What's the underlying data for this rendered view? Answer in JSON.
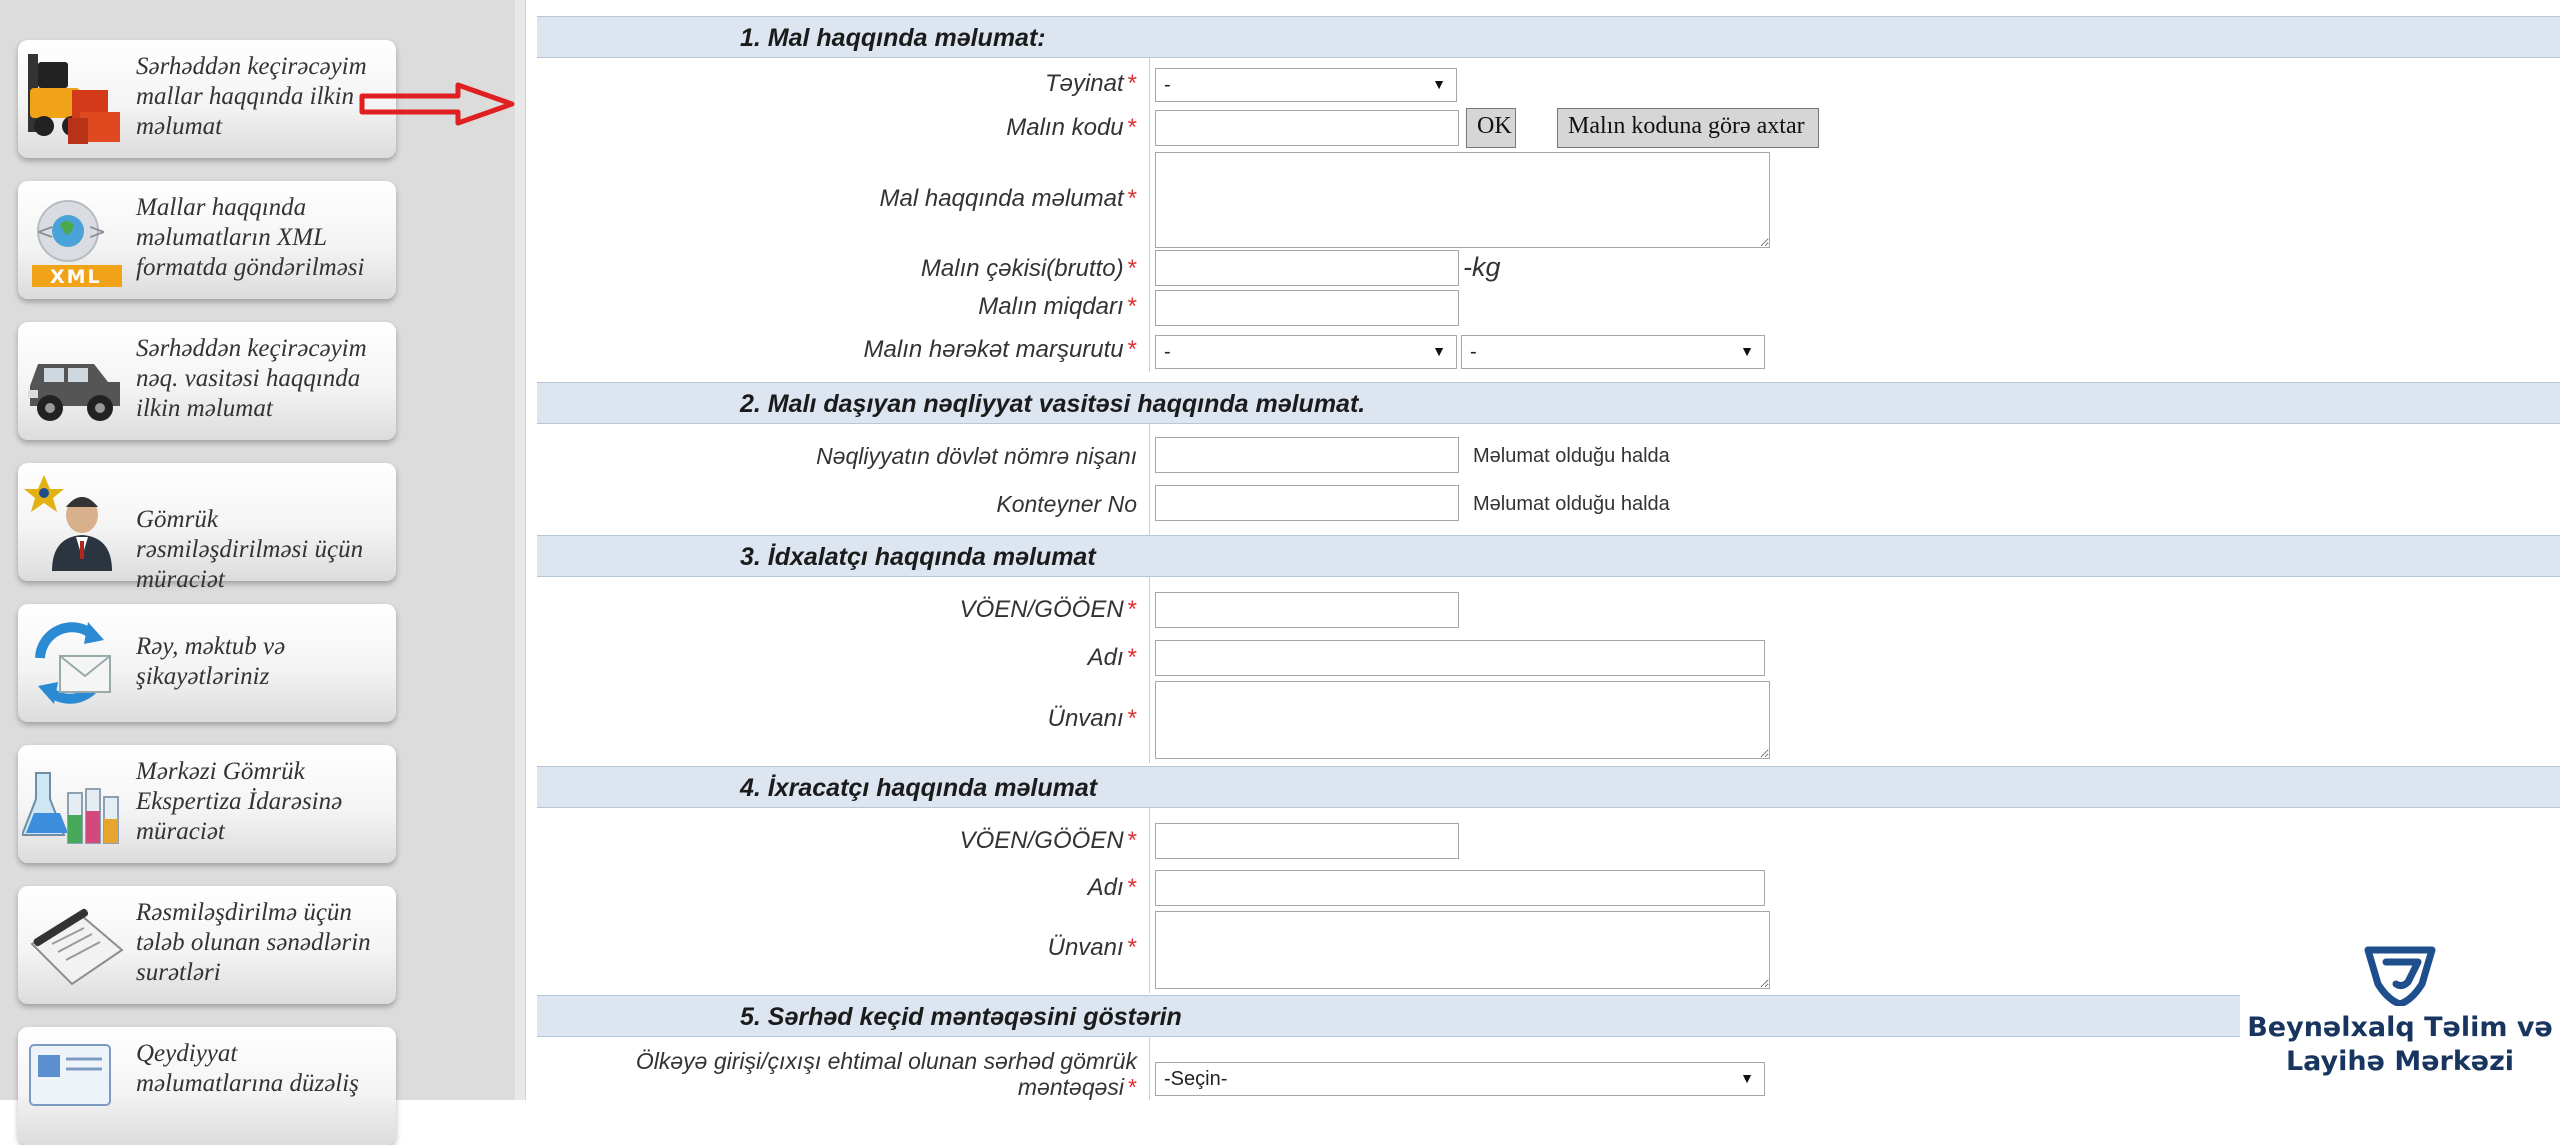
{
  "sidebar": {
    "items": [
      {
        "label": "Sərhəddən keçirəcəyim mallar haqqında ilkin məlumat",
        "icon": "forklift-cargo-icon"
      },
      {
        "label": "Mallar haqqında məlumatların XML formatda göndərilməsi",
        "icon": "xml-globe-icon",
        "badge": "XML"
      },
      {
        "label": "Sərhəddən keçirəcəyim nəq. vasitəsi haqqında ilkin məlumat",
        "icon": "jeep-icon"
      },
      {
        "label": "Gömrük rəsmiləşdirilməsi üçün müraciət",
        "icon": "customs-officer-icon"
      },
      {
        "label": "Rəy, məktub və şikayətləriniz",
        "icon": "mail-feedback-icon"
      },
      {
        "label": "Mərkəzi Gömrük Ekspertiza İdarəsinə müraciət",
        "icon": "laboratory-icon"
      },
      {
        "label": "Rəsmiləşdirilmə üçün tələb olunan sənədlərin surətləri",
        "icon": "documents-pen-icon"
      },
      {
        "label": "Qeydiyyat məlumatlarına düzəliş",
        "icon": "registration-edit-icon"
      }
    ]
  },
  "accent_arrow_color": "#e02020",
  "sections": {
    "s1": {
      "title": "1. Mal haqqında məlumat:",
      "purpose_label": "Təyinat",
      "purpose_value": "-",
      "code_label": "Malın kodu",
      "ok_button": "OK",
      "search_button": "Malın koduna görə axtar",
      "info_label": "Mal haqqında məlumat",
      "weight_label": "Malın çəkisi(brutto)",
      "weight_unit": "-kg",
      "quantity_label": "Malın miqdarı",
      "route_label": "Malın hərəkət marşurutu",
      "route_from": "-",
      "route_to": "-"
    },
    "s2": {
      "title": "2. Malı daşıyan nəqliyyat vasitəsi haqqında məlumat.",
      "plate_label": "Nəqliyyatın dövlət nömrə nişanı",
      "plate_note": "Məlumat olduğu halda",
      "container_label": "Konteyner No",
      "container_note": "Məlumat olduğu halda"
    },
    "s3": {
      "title": "3. İdxalatçı haqqında məlumat",
      "tin_label": "VÖEN/GÖÖEN",
      "name_label": "Adı",
      "address_label": "Ünvanı"
    },
    "s4": {
      "title": "4. İxracatçı haqqında məlumat",
      "tin_label": "VÖEN/GÖÖEN",
      "name_label": "Adı",
      "address_label": "Ünvanı"
    },
    "s5": {
      "title": "5. Sərhəd keçid məntəqəsini göstərin",
      "border_label_1": "Ölkəyə girişi/çıxışı ehtimal olunan sərhəd gömrük",
      "border_label_2": "məntəqəsi",
      "border_value": "-Seçin-"
    }
  },
  "required_mark": "*",
  "logo": {
    "line1": "Beynəlxalq Təlim və",
    "line2": "Layihə Mərkəzi",
    "color": "#1f4e8c"
  }
}
